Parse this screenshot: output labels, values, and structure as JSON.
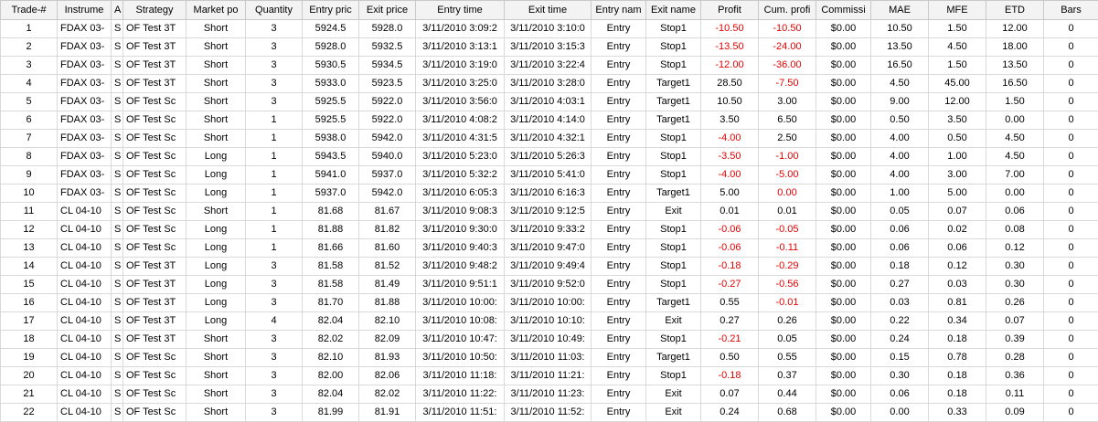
{
  "columns": [
    "Trade-#",
    "Instrume",
    "A",
    "Strategy",
    "Market po",
    "Quantity",
    "Entry pric",
    "Exit price",
    "Entry time",
    "Exit time",
    "Entry nam",
    "Exit name",
    "Profit",
    "Cum. profi",
    "Commissi",
    "MAE",
    "MFE",
    "ETD",
    "Bars"
  ],
  "negative_color": "#e60000",
  "rows": [
    [
      "1",
      "FDAX 03-",
      "S",
      "OF Test 3T",
      "Short",
      "3",
      "5924.5",
      "5928.0",
      "3/11/2010 3:09:2",
      "3/11/2010 3:10:0",
      "Entry",
      "Stop1",
      "-10.50",
      "-10.50",
      "$0.00",
      "10.50",
      "1.50",
      "12.00",
      "0"
    ],
    [
      "2",
      "FDAX 03-",
      "S",
      "OF Test 3T",
      "Short",
      "3",
      "5928.0",
      "5932.5",
      "3/11/2010 3:13:1",
      "3/11/2010 3:15:3",
      "Entry",
      "Stop1",
      "-13.50",
      "-24.00",
      "$0.00",
      "13.50",
      "4.50",
      "18.00",
      "0"
    ],
    [
      "3",
      "FDAX 03-",
      "S",
      "OF Test 3T",
      "Short",
      "3",
      "5930.5",
      "5934.5",
      "3/11/2010 3:19:0",
      "3/11/2010 3:22:4",
      "Entry",
      "Stop1",
      "-12.00",
      "-36.00",
      "$0.00",
      "16.50",
      "1.50",
      "13.50",
      "0"
    ],
    [
      "4",
      "FDAX 03-",
      "S",
      "OF Test 3T",
      "Short",
      "3",
      "5933.0",
      "5923.5",
      "3/11/2010 3:25:0",
      "3/11/2010 3:28:0",
      "Entry",
      "Target1",
      "28.50",
      "-7.50",
      "$0.00",
      "4.50",
      "45.00",
      "16.50",
      "0"
    ],
    [
      "5",
      "FDAX 03-",
      "S",
      "OF Test Sc",
      "Short",
      "3",
      "5925.5",
      "5922.0",
      "3/11/2010 3:56:0",
      "3/11/2010 4:03:1",
      "Entry",
      "Target1",
      "10.50",
      "3.00",
      "$0.00",
      "9.00",
      "12.00",
      "1.50",
      "0"
    ],
    [
      "6",
      "FDAX 03-",
      "S",
      "OF Test Sc",
      "Short",
      "1",
      "5925.5",
      "5922.0",
      "3/11/2010 4:08:2",
      "3/11/2010 4:14:0",
      "Entry",
      "Target1",
      "3.50",
      "6.50",
      "$0.00",
      "0.50",
      "3.50",
      "0.00",
      "0"
    ],
    [
      "7",
      "FDAX 03-",
      "S",
      "OF Test Sc",
      "Short",
      "1",
      "5938.0",
      "5942.0",
      "3/11/2010 4:31:5",
      "3/11/2010 4:32:1",
      "Entry",
      "Stop1",
      "-4.00",
      "2.50",
      "$0.00",
      "4.00",
      "0.50",
      "4.50",
      "0"
    ],
    [
      "8",
      "FDAX 03-",
      "S",
      "OF Test Sc",
      "Long",
      "1",
      "5943.5",
      "5940.0",
      "3/11/2010 5:23:0",
      "3/11/2010 5:26:3",
      "Entry",
      "Stop1",
      "-3.50",
      "-1.00",
      "$0.00",
      "4.00",
      "1.00",
      "4.50",
      "0"
    ],
    [
      "9",
      "FDAX 03-",
      "S",
      "OF Test Sc",
      "Long",
      "1",
      "5941.0",
      "5937.0",
      "3/11/2010 5:32:2",
      "3/11/2010 5:41:0",
      "Entry",
      "Stop1",
      "-4.00",
      "-5.00",
      "$0.00",
      "4.00",
      "3.00",
      "7.00",
      "0"
    ],
    [
      "10",
      "FDAX 03-",
      "S",
      "OF Test Sc",
      "Long",
      "1",
      "5937.0",
      "5942.0",
      "3/11/2010 6:05:3",
      "3/11/2010 6:16:3",
      "Entry",
      "Target1",
      "5.00",
      "0.00",
      "$0.00",
      "1.00",
      "5.00",
      "0.00",
      "0"
    ],
    [
      "11",
      "CL 04-10",
      "S",
      "OF Test Sc",
      "Short",
      "1",
      "81.68",
      "81.67",
      "3/11/2010 9:08:3",
      "3/11/2010 9:12:5",
      "Entry",
      "Exit",
      "0.01",
      "0.01",
      "$0.00",
      "0.05",
      "0.07",
      "0.06",
      "0"
    ],
    [
      "12",
      "CL 04-10",
      "S",
      "OF Test Sc",
      "Long",
      "1",
      "81.88",
      "81.82",
      "3/11/2010 9:30:0",
      "3/11/2010 9:33:2",
      "Entry",
      "Stop1",
      "-0.06",
      "-0.05",
      "$0.00",
      "0.06",
      "0.02",
      "0.08",
      "0"
    ],
    [
      "13",
      "CL 04-10",
      "S",
      "OF Test Sc",
      "Long",
      "1",
      "81.66",
      "81.60",
      "3/11/2010 9:40:3",
      "3/11/2010 9:47:0",
      "Entry",
      "Stop1",
      "-0.06",
      "-0.11",
      "$0.00",
      "0.06",
      "0.06",
      "0.12",
      "0"
    ],
    [
      "14",
      "CL 04-10",
      "S",
      "OF Test 3T",
      "Long",
      "3",
      "81.58",
      "81.52",
      "3/11/2010 9:48:2",
      "3/11/2010 9:49:4",
      "Entry",
      "Stop1",
      "-0.18",
      "-0.29",
      "$0.00",
      "0.18",
      "0.12",
      "0.30",
      "0"
    ],
    [
      "15",
      "CL 04-10",
      "S",
      "OF Test 3T",
      "Long",
      "3",
      "81.58",
      "81.49",
      "3/11/2010 9:51:1",
      "3/11/2010 9:52:0",
      "Entry",
      "Stop1",
      "-0.27",
      "-0.56",
      "$0.00",
      "0.27",
      "0.03",
      "0.30",
      "0"
    ],
    [
      "16",
      "CL 04-10",
      "S",
      "OF Test 3T",
      "Long",
      "3",
      "81.70",
      "81.88",
      "3/11/2010 10:00:",
      "3/11/2010 10:00:",
      "Entry",
      "Target1",
      "0.55",
      "-0.01",
      "$0.00",
      "0.03",
      "0.81",
      "0.26",
      "0"
    ],
    [
      "17",
      "CL 04-10",
      "S",
      "OF Test 3T",
      "Long",
      "4",
      "82.04",
      "82.10",
      "3/11/2010 10:08:",
      "3/11/2010 10:10:",
      "Entry",
      "Exit",
      "0.27",
      "0.26",
      "$0.00",
      "0.22",
      "0.34",
      "0.07",
      "0"
    ],
    [
      "18",
      "CL 04-10",
      "S",
      "OF Test 3T",
      "Short",
      "3",
      "82.02",
      "82.09",
      "3/11/2010 10:47:",
      "3/11/2010 10:49:",
      "Entry",
      "Stop1",
      "-0.21",
      "0.05",
      "$0.00",
      "0.24",
      "0.18",
      "0.39",
      "0"
    ],
    [
      "19",
      "CL 04-10",
      "S",
      "OF Test Sc",
      "Short",
      "3",
      "82.10",
      "81.93",
      "3/11/2010 10:50:",
      "3/11/2010 11:03:",
      "Entry",
      "Target1",
      "0.50",
      "0.55",
      "$0.00",
      "0.15",
      "0.78",
      "0.28",
      "0"
    ],
    [
      "20",
      "CL 04-10",
      "S",
      "OF Test Sc",
      "Short",
      "3",
      "82.00",
      "82.06",
      "3/11/2010 11:18:",
      "3/11/2010 11:21:",
      "Entry",
      "Stop1",
      "-0.18",
      "0.37",
      "$0.00",
      "0.30",
      "0.18",
      "0.36",
      "0"
    ],
    [
      "21",
      "CL 04-10",
      "S",
      "OF Test Sc",
      "Short",
      "3",
      "82.04",
      "82.02",
      "3/11/2010 11:22:",
      "3/11/2010 11:23:",
      "Entry",
      "Exit",
      "0.07",
      "0.44",
      "$0.00",
      "0.06",
      "0.18",
      "0.11",
      "0"
    ],
    [
      "22",
      "CL 04-10",
      "S",
      "OF Test Sc",
      "Short",
      "3",
      "81.99",
      "81.91",
      "3/11/2010 11:51:",
      "3/11/2010 11:52:",
      "Entry",
      "Exit",
      "0.24",
      "0.68",
      "$0.00",
      "0.00",
      "0.33",
      "0.09",
      "0"
    ]
  ]
}
